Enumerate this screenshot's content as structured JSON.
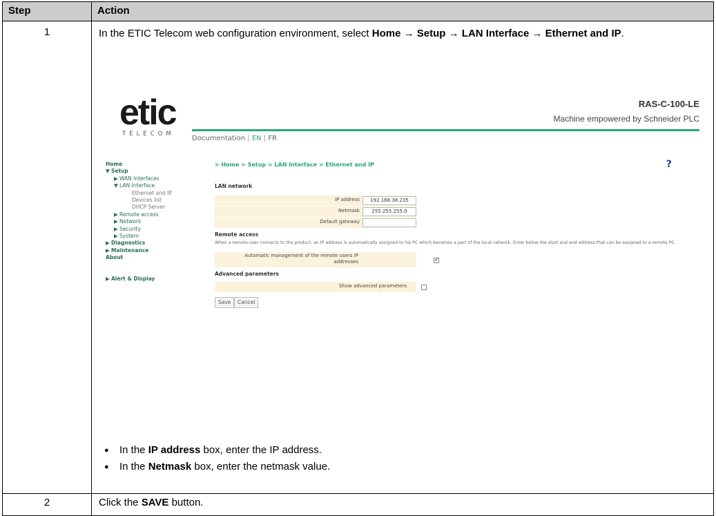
{
  "table": {
    "headers": {
      "step": "Step",
      "action": "Action"
    },
    "row1": {
      "step": "1",
      "intro_prefix": "In the ETIC Telecom web configuration environment, select ",
      "path_bold": "Home → Setup → LAN Interface → Ethernet and IP",
      "intro_suffix": ".",
      "bullets": [
        {
          "pre": "In the ",
          "bold": "IP address",
          "post": " box, enter the IP address."
        },
        {
          "pre": "In the ",
          "bold": "Netmask",
          "post": " box, enter the netmask value."
        }
      ]
    },
    "row2": {
      "step": "2",
      "pre": "Click the ",
      "bold": "SAVE",
      "post": " button."
    }
  },
  "screenshot": {
    "logo_main": "etic",
    "logo_sub": "TELECOM",
    "product": "RAS-C-100-LE",
    "tagline": "Machine empowered by Schneider PLC",
    "doc_links": {
      "doc": "Documentation",
      "en": "EN",
      "fr": "FR"
    },
    "breadcrumb": "> Home > Setup > LAN Interface > Ethernet and IP",
    "help": "?",
    "nav": {
      "home": "Home",
      "setup": "Setup",
      "wan": "WAN Interfaces",
      "lan": "LAN Interface",
      "eth": "Ethernet and IP",
      "devices": "Devices list",
      "dhcp": "DHCP Server",
      "remote": "Remote access",
      "network": "Network",
      "security": "Security",
      "system": "System",
      "diagnostics": "Diagnostics",
      "maintenance": "Maintenance",
      "about": "About",
      "alert": "Alert & Display"
    },
    "lan_network": {
      "title": "LAN network",
      "ip_label": "IP address",
      "ip_value": "192.168.38.235",
      "netmask_label": "Netmask",
      "netmask_value": "255.255.255.0",
      "gateway_label": "Default gateway",
      "gateway_value": ""
    },
    "remote_access": {
      "title": "Remote access",
      "note": "When a remote user connects to the product, an IP address is automatically assigned to his PC which becomes a part of the local network. Enter below the start and end address that can be assigned to a remote PC.",
      "auto_label_1": "Automatic management of the remote users IP",
      "auto_label_2": "addresses",
      "auto_checked": "✔"
    },
    "advanced": {
      "title": "Advanced parameters",
      "show_label": "Show advanced parameters"
    },
    "buttons": {
      "save": "Save",
      "cancel": "Cancel"
    }
  }
}
